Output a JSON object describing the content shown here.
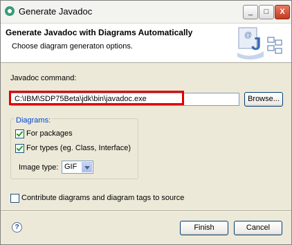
{
  "window": {
    "title": "Generate Javadoc",
    "controls": {
      "minimize": "_",
      "maximize": "□",
      "close": "X"
    }
  },
  "header": {
    "title": "Generate Javadoc with Diagrams Automatically",
    "subtitle": "Choose diagram generaton options."
  },
  "javadoc": {
    "label": "Javadoc command:",
    "value": "C:\\IBM\\SDP75Beta\\jdk\\bin\\javadoc.exe",
    "browse_label": "Browse..."
  },
  "diagrams": {
    "legend": "Diagrams:",
    "for_packages": {
      "label": "For packages",
      "checked": true
    },
    "for_types": {
      "label": "For types (eg. Class, Interface)",
      "checked": true
    },
    "image_type_label": "Image type:",
    "image_type_value": "GIF"
  },
  "contribute": {
    "label": "Contribute diagrams and diagram tags to source",
    "checked": false
  },
  "footer": {
    "help_icon": "?",
    "finish_label": "Finish",
    "cancel_label": "Cancel"
  },
  "colors": {
    "highlight": "#e00000",
    "dialog_bg": "#ece9d8",
    "legend": "#0046d5"
  }
}
